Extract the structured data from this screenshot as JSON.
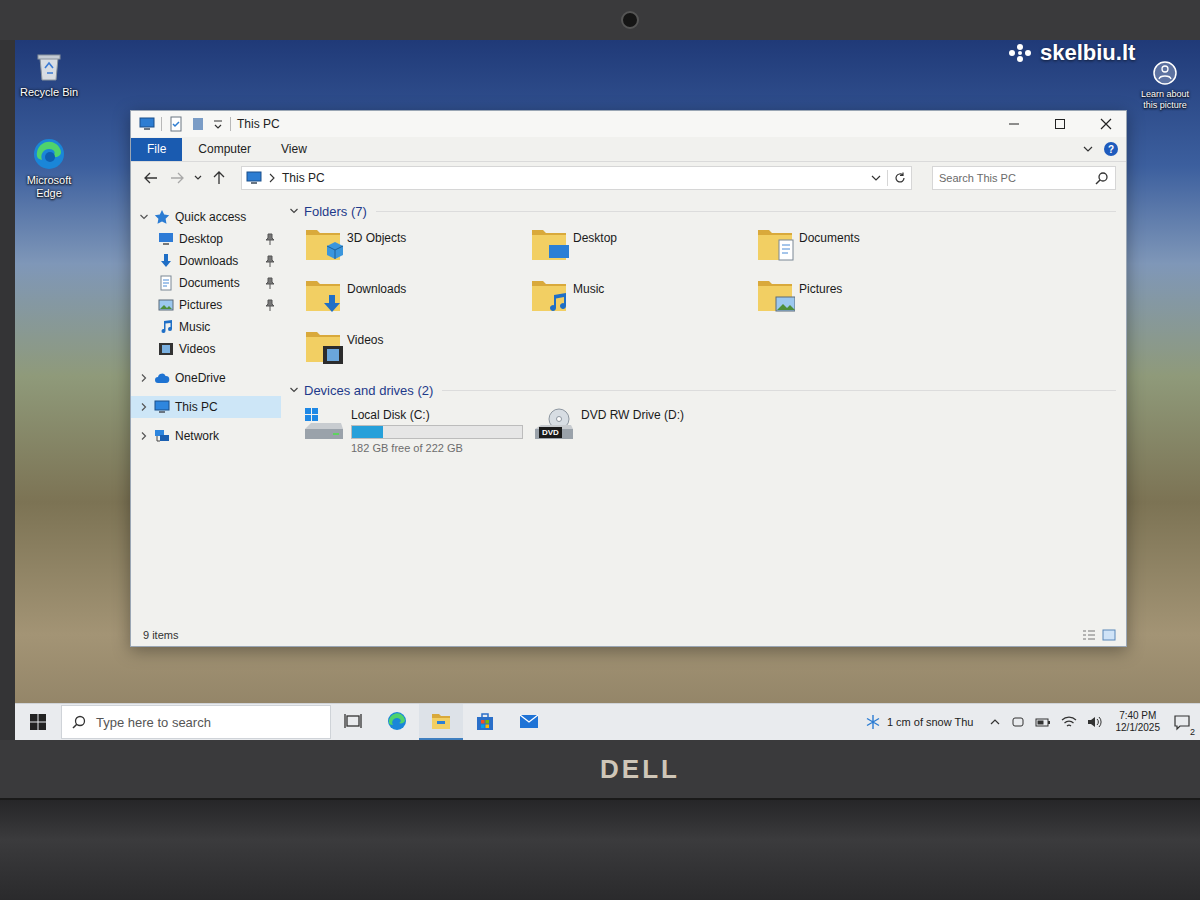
{
  "watermark": {
    "text": "skelbiu.lt"
  },
  "laptop": {
    "brand": "DELL"
  },
  "desktop": {
    "icons": [
      {
        "label": "Recycle Bin"
      },
      {
        "label": "Microsoft Edge"
      }
    ],
    "spotlight": {
      "label": "Learn about this picture"
    }
  },
  "window": {
    "title": "This PC",
    "help": "?"
  },
  "ribbon": {
    "tabs": [
      {
        "label": "File",
        "selected": true
      },
      {
        "label": "Computer",
        "selected": false
      },
      {
        "label": "View",
        "selected": false
      }
    ]
  },
  "address": {
    "path": "This PC"
  },
  "search": {
    "placeholder": "Search This PC"
  },
  "sidebar": {
    "items": [
      {
        "label": "Quick access",
        "kind": "group",
        "expanded": true,
        "selected": false
      },
      {
        "label": "Desktop",
        "kind": "item",
        "pinned": true,
        "selected": false
      },
      {
        "label": "Downloads",
        "kind": "item",
        "pinned": true,
        "selected": false
      },
      {
        "label": "Documents",
        "kind": "item",
        "pinned": true,
        "selected": false
      },
      {
        "label": "Pictures",
        "kind": "item",
        "pinned": true,
        "selected": false
      },
      {
        "label": "Music",
        "kind": "item",
        "pinned": false,
        "selected": false
      },
      {
        "label": "Videos",
        "kind": "item",
        "pinned": false,
        "selected": false
      },
      {
        "label": "OneDrive",
        "kind": "group",
        "expanded": false,
        "selected": false
      },
      {
        "label": "This PC",
        "kind": "group",
        "expanded": false,
        "selected": true
      },
      {
        "label": "Network",
        "kind": "group",
        "expanded": false,
        "selected": false
      }
    ]
  },
  "folders": {
    "title": "Folders (7)",
    "expanded": true,
    "items": [
      {
        "label": "3D Objects"
      },
      {
        "label": "Desktop"
      },
      {
        "label": "Documents"
      },
      {
        "label": "Downloads"
      },
      {
        "label": "Music"
      },
      {
        "label": "Pictures"
      },
      {
        "label": "Videos"
      }
    ]
  },
  "drives": {
    "title": "Devices and drives (2)",
    "expanded": true,
    "items": [
      {
        "label": "Local Disk (C:)",
        "kind": "disk",
        "level": 0.18,
        "detail": "182 GB free of 222 GB"
      },
      {
        "label": "DVD RW Drive (D:)",
        "kind": "optical",
        "badge": "DVD"
      }
    ]
  },
  "status_bar": {
    "count": "9 items"
  },
  "taskbar": {
    "search_placeholder": "Type here to search",
    "apps": [
      {
        "running": false
      },
      {
        "running": false
      },
      {
        "running": true
      },
      {
        "running": false
      },
      {
        "running": false
      }
    ],
    "weather": "1 cm of snow Thu",
    "time": "7:40 PM",
    "date": "12/1/2025",
    "notifications": "2"
  }
}
